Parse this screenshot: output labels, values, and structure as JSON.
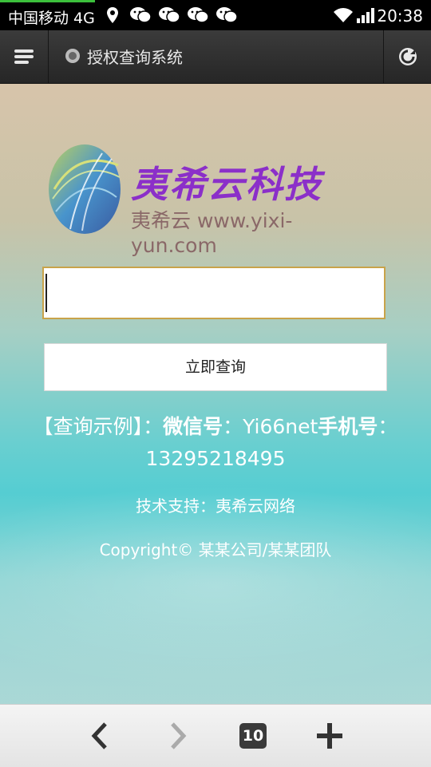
{
  "status_bar": {
    "carrier": "中国移动 4G",
    "time": "20:38",
    "load_progress": 0.22
  },
  "address_bar": {
    "title": "授权查询系统"
  },
  "logo": {
    "title": "夷希云科技",
    "subtitle": "夷希云 www.yixi-yun.com"
  },
  "form": {
    "input_value": "",
    "submit_label": "立即查询"
  },
  "info": {
    "example_prefix": "【查询示例】：",
    "wechat_label": "微信号",
    "wechat_sep": "：Yi66net",
    "phone_label": "手机号",
    "phone_value": "：13295218495",
    "support": "技术支持：夷希云网络",
    "copyright": "Copyright© 某某公司/某某团队"
  },
  "bottom_bar": {
    "tab_count": "10"
  },
  "colors": {
    "logo_purple": "#8b2fc9",
    "input_border": "#c9a34a",
    "progress_green": "#3cc03c"
  }
}
